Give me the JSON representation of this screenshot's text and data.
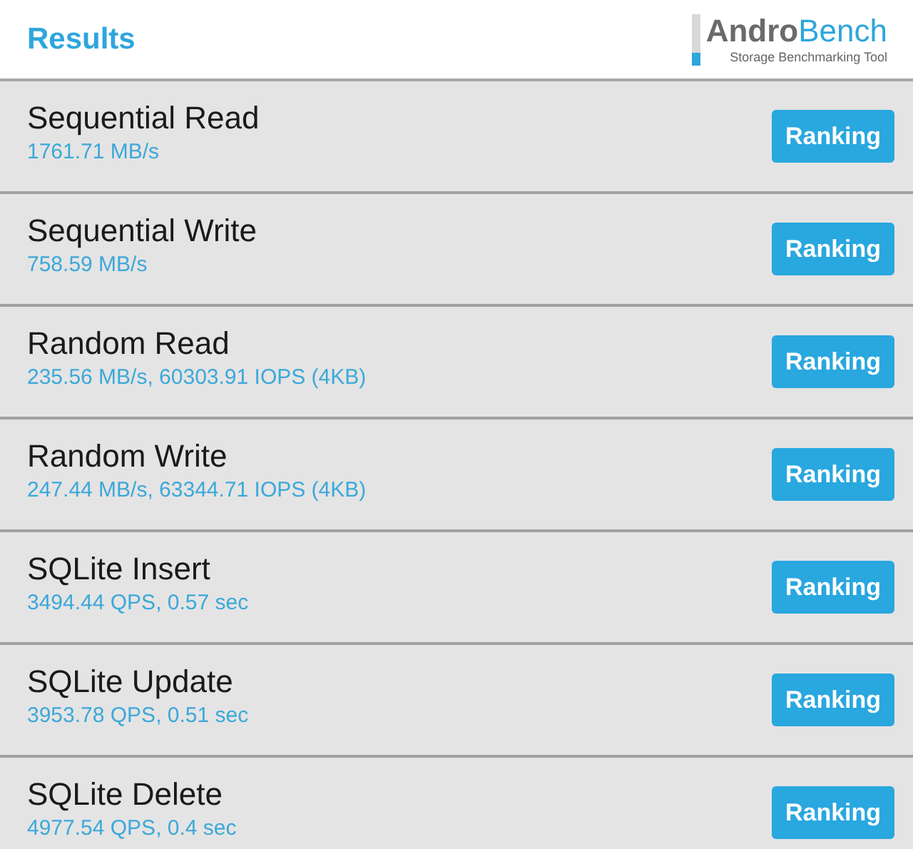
{
  "header": {
    "title": "Results",
    "logo": {
      "parts": [
        "Andro",
        "Bench"
      ],
      "tagline": "Storage Benchmarking Tool"
    }
  },
  "results": [
    {
      "name": "Sequential Read",
      "value": "1761.71 MB/s",
      "button": "Ranking"
    },
    {
      "name": "Sequential Write",
      "value": "758.59 MB/s",
      "button": "Ranking"
    },
    {
      "name": "Random Read",
      "value": "235.56 MB/s, 60303.91 IOPS (4KB)",
      "button": "Ranking"
    },
    {
      "name": "Random Write",
      "value": "247.44 MB/s, 63344.71 IOPS (4KB)",
      "button": "Ranking"
    },
    {
      "name": "SQLite Insert",
      "value": "3494.44 QPS, 0.57 sec",
      "button": "Ranking"
    },
    {
      "name": "SQLite Update",
      "value": "3953.78 QPS, 0.51 sec",
      "button": "Ranking"
    },
    {
      "name": "SQLite Delete",
      "value": "4977.54 QPS, 0.4 sec",
      "button": "Ranking"
    }
  ]
}
